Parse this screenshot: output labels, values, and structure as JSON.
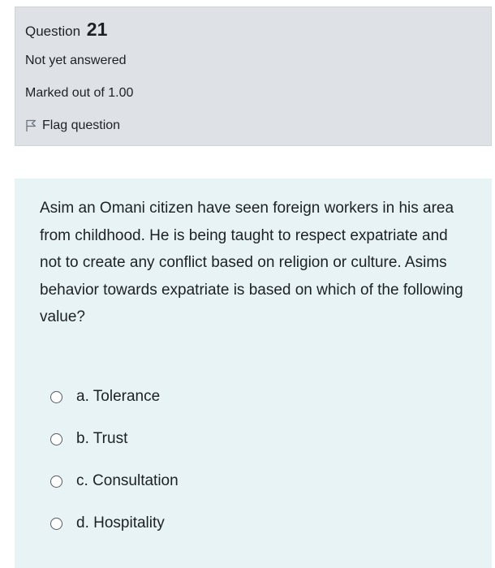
{
  "question_info": {
    "label": "Question",
    "number": "21",
    "state": "Not yet answered",
    "grade": "Marked out of 1.00",
    "flag_label": "Flag question"
  },
  "question": {
    "text": "Asim an Omani citizen have seen foreign workers in his area from childhood. He is being taught to respect expatriate and not to create any conflict based on religion or culture. Asims behavior towards expatriate is based on which of the following value?",
    "answers": [
      {
        "label": "a. Tolerance"
      },
      {
        "label": "b. Trust"
      },
      {
        "label": "c. Consultation"
      },
      {
        "label": "d. Hospitality"
      }
    ]
  },
  "colors": {
    "info_background": "#dee2e6",
    "content_background": "#e7f3f5",
    "text": "#1d2125"
  }
}
